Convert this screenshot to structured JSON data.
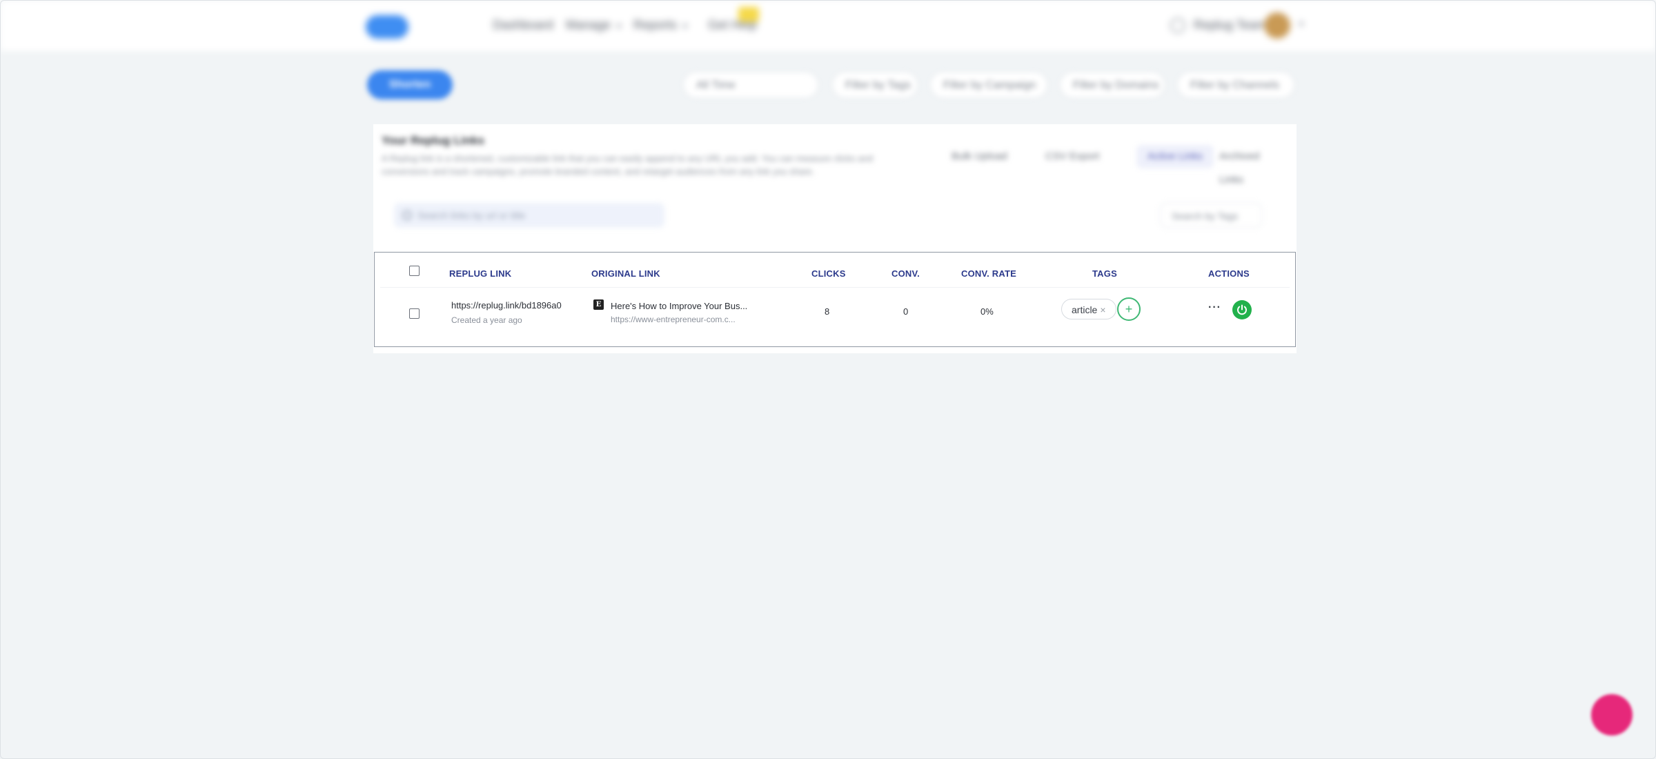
{
  "nav": {
    "items": [
      "Dashboard",
      "Manage",
      "Reports",
      "Get Help"
    ],
    "user_name": "Replug Team"
  },
  "filters": {
    "new_button": "Shorten",
    "items": [
      "All Time",
      "Filter by Tags",
      "Filter by Campaign",
      "Filter by Domains",
      "Filter by Channels"
    ]
  },
  "card": {
    "title": "Your Replug Links",
    "description": "A Replug link is a shortened, customizable link that you can easily append to any URL you add. You can measure clicks and conversions and track campaigns, promote branded content, and retarget audiences from any link you share.",
    "head_buttons": [
      "Bulk Upload",
      "CSV Export",
      "Active Links",
      "Archived Links"
    ],
    "search_placeholder": "Search links by url or title",
    "tag_filter": "Search by Tags"
  },
  "table": {
    "headers": {
      "replug_link": "REPLUG LINK",
      "original_link": "ORIGINAL LINK",
      "clicks": "CLICKS",
      "conv": "CONV.",
      "conv_rate": "CONV. RATE",
      "tags": "TAGS",
      "actions": "ACTIONS"
    },
    "rows": [
      {
        "short_url": "https://replug.link/bd1896a0",
        "created": "Created a year ago",
        "favicon": "E",
        "title": "Here's How to Improve Your Bus...",
        "url": "https://www-entrepreneur-com.c...",
        "clicks": "8",
        "conv": "0",
        "conv_rate": "0%",
        "tag": "article",
        "tag_remove": "×",
        "add_tag": "+",
        "more": "···"
      }
    ]
  },
  "colors": {
    "accent": "#3b86ef",
    "header_text": "#2c3a8c",
    "success": "#22b14c",
    "chat": "#e6287a"
  },
  "icons": {
    "power": "power-icon",
    "more": "more-icon",
    "chat": "chat-icon"
  }
}
